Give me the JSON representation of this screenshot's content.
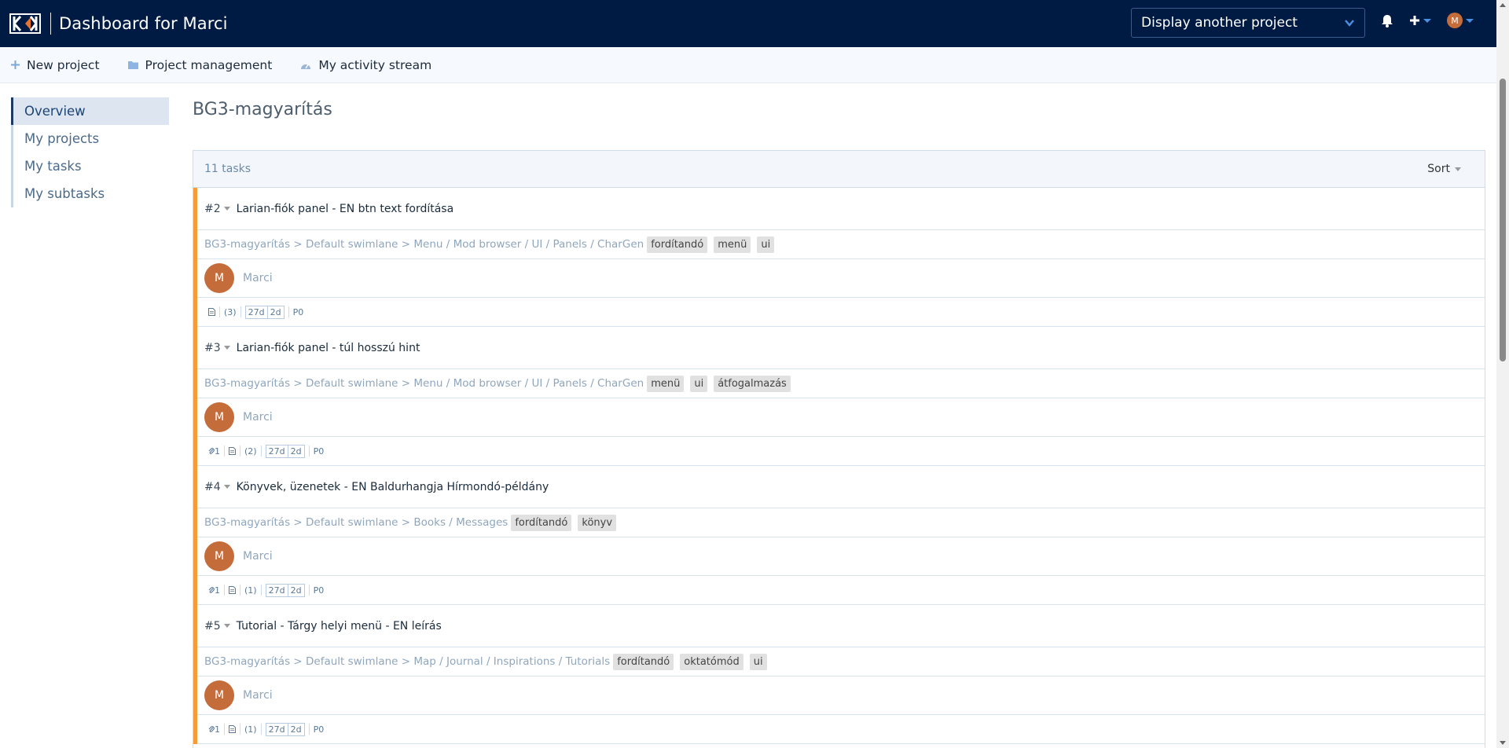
{
  "header": {
    "title": "Dashboard for Marci",
    "project_select": "Display another project",
    "user_initial": "M"
  },
  "subnav": {
    "new_project": "New project",
    "project_management": "Project management",
    "activity_stream": "My activity stream"
  },
  "sidebar": {
    "items": [
      {
        "label": "Overview"
      },
      {
        "label": "My projects"
      },
      {
        "label": "My tasks"
      },
      {
        "label": "My subtasks"
      }
    ]
  },
  "page": {
    "title": "BG3-magyarítás",
    "task_count": "11 tasks",
    "sort_label": "Sort"
  },
  "colors": {
    "accent_orange": "#f59c38",
    "header_bg": "#001b43",
    "avatar": "#c46c3a"
  },
  "tasks": [
    {
      "number": "#2",
      "title": "Larian-fiók panel - EN btn text fordítása",
      "path": "BG3-magyarítás > Default swimlane > Menu / Mod browser / UI / Panels / CharGen",
      "tags": [
        "fordítandó",
        "menü",
        "ui"
      ],
      "assignee_initial": "M",
      "assignee": "Marci",
      "attachments": "",
      "subtasks": "(3)",
      "age": "27d",
      "updated": "2d",
      "priority": "P0"
    },
    {
      "number": "#3",
      "title": "Larian-fiók panel - túl hosszú hint",
      "path": "BG3-magyarítás > Default swimlane > Menu / Mod browser / UI / Panels / CharGen",
      "tags": [
        "menü",
        "ui",
        "átfogalmazás"
      ],
      "assignee_initial": "M",
      "assignee": "Marci",
      "attachments": "1",
      "subtasks": "(2)",
      "age": "27d",
      "updated": "2d",
      "priority": "P0"
    },
    {
      "number": "#4",
      "title": "Könyvek, üzenetek - EN Baldurhangja Hírmondó-példány",
      "path": "BG3-magyarítás > Default swimlane > Books / Messages",
      "tags": [
        "fordítandó",
        "könyv"
      ],
      "assignee_initial": "M",
      "assignee": "Marci",
      "attachments": "1",
      "subtasks": "(1)",
      "age": "27d",
      "updated": "2d",
      "priority": "P0"
    },
    {
      "number": "#5",
      "title": "Tutorial - Tárgy helyi menü - EN leírás",
      "path": "BG3-magyarítás > Default swimlane > Map / Journal / Inspirations / Tutorials",
      "tags": [
        "fordítandó",
        "oktatómód",
        "ui"
      ],
      "assignee_initial": "M",
      "assignee": "Marci",
      "attachments": "1",
      "subtasks": "(1)",
      "age": "27d",
      "updated": "2d",
      "priority": "P0"
    }
  ]
}
